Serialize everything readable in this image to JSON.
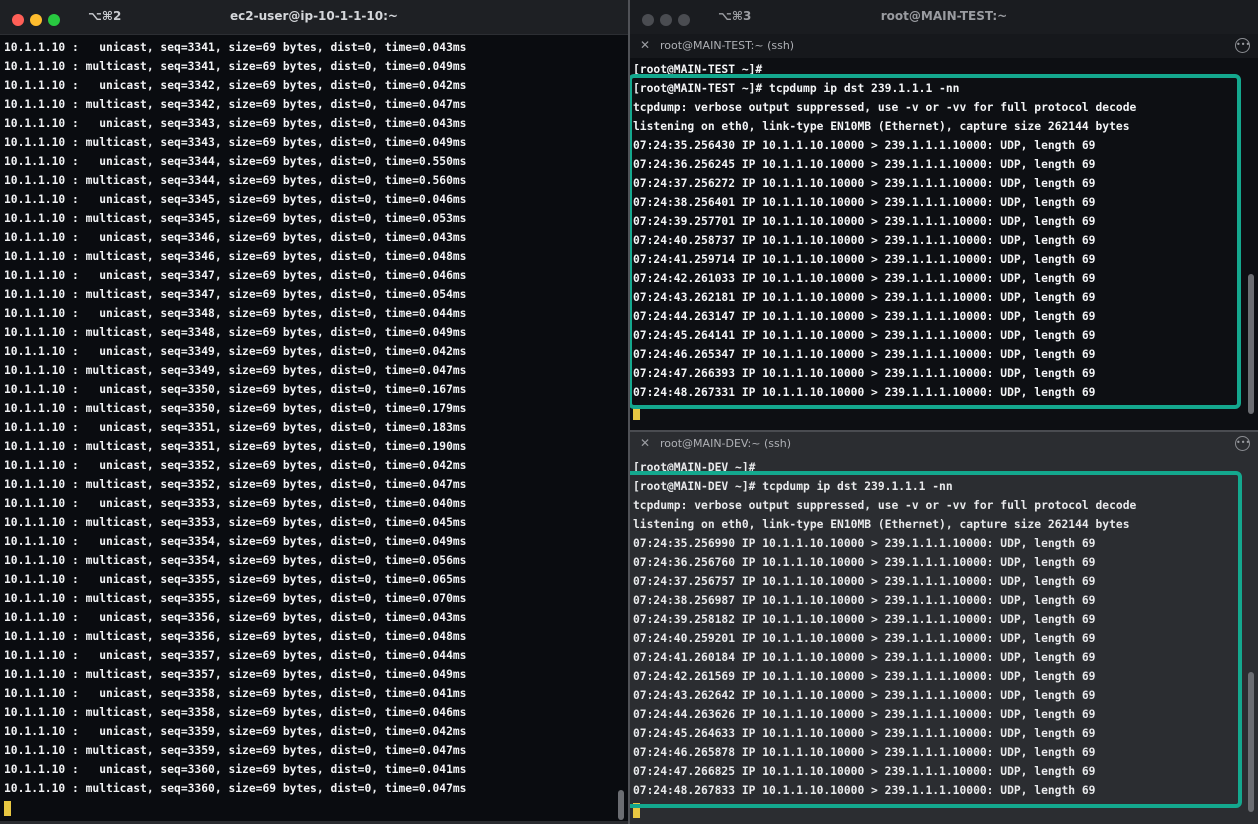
{
  "left_window": {
    "shortcut": "⌥⌘2",
    "title": "ec2-user@ip-10-1-1-10:~",
    "lines": [
      "10.1.1.10 :   unicast, seq=3341, size=69 bytes, dist=0, time=0.043ms",
      "10.1.1.10 : multicast, seq=3341, size=69 bytes, dist=0, time=0.049ms",
      "10.1.1.10 :   unicast, seq=3342, size=69 bytes, dist=0, time=0.042ms",
      "10.1.1.10 : multicast, seq=3342, size=69 bytes, dist=0, time=0.047ms",
      "10.1.1.10 :   unicast, seq=3343, size=69 bytes, dist=0, time=0.043ms",
      "10.1.1.10 : multicast, seq=3343, size=69 bytes, dist=0, time=0.049ms",
      "10.1.1.10 :   unicast, seq=3344, size=69 bytes, dist=0, time=0.550ms",
      "10.1.1.10 : multicast, seq=3344, size=69 bytes, dist=0, time=0.560ms",
      "10.1.1.10 :   unicast, seq=3345, size=69 bytes, dist=0, time=0.046ms",
      "10.1.1.10 : multicast, seq=3345, size=69 bytes, dist=0, time=0.053ms",
      "10.1.1.10 :   unicast, seq=3346, size=69 bytes, dist=0, time=0.043ms",
      "10.1.1.10 : multicast, seq=3346, size=69 bytes, dist=0, time=0.048ms",
      "10.1.1.10 :   unicast, seq=3347, size=69 bytes, dist=0, time=0.046ms",
      "10.1.1.10 : multicast, seq=3347, size=69 bytes, dist=0, time=0.054ms",
      "10.1.1.10 :   unicast, seq=3348, size=69 bytes, dist=0, time=0.044ms",
      "10.1.1.10 : multicast, seq=3348, size=69 bytes, dist=0, time=0.049ms",
      "10.1.1.10 :   unicast, seq=3349, size=69 bytes, dist=0, time=0.042ms",
      "10.1.1.10 : multicast, seq=3349, size=69 bytes, dist=0, time=0.047ms",
      "10.1.1.10 :   unicast, seq=3350, size=69 bytes, dist=0, time=0.167ms",
      "10.1.1.10 : multicast, seq=3350, size=69 bytes, dist=0, time=0.179ms",
      "10.1.1.10 :   unicast, seq=3351, size=69 bytes, dist=0, time=0.183ms",
      "10.1.1.10 : multicast, seq=3351, size=69 bytes, dist=0, time=0.190ms",
      "10.1.1.10 :   unicast, seq=3352, size=69 bytes, dist=0, time=0.042ms",
      "10.1.1.10 : multicast, seq=3352, size=69 bytes, dist=0, time=0.047ms",
      "10.1.1.10 :   unicast, seq=3353, size=69 bytes, dist=0, time=0.040ms",
      "10.1.1.10 : multicast, seq=3353, size=69 bytes, dist=0, time=0.045ms",
      "10.1.1.10 :   unicast, seq=3354, size=69 bytes, dist=0, time=0.049ms",
      "10.1.1.10 : multicast, seq=3354, size=69 bytes, dist=0, time=0.056ms",
      "10.1.1.10 :   unicast, seq=3355, size=69 bytes, dist=0, time=0.065ms",
      "10.1.1.10 : multicast, seq=3355, size=69 bytes, dist=0, time=0.070ms",
      "10.1.1.10 :   unicast, seq=3356, size=69 bytes, dist=0, time=0.043ms",
      "10.1.1.10 : multicast, seq=3356, size=69 bytes, dist=0, time=0.048ms",
      "10.1.1.10 :   unicast, seq=3357, size=69 bytes, dist=0, time=0.044ms",
      "10.1.1.10 : multicast, seq=3357, size=69 bytes, dist=0, time=0.049ms",
      "10.1.1.10 :   unicast, seq=3358, size=69 bytes, dist=0, time=0.041ms",
      "10.1.1.10 : multicast, seq=3358, size=69 bytes, dist=0, time=0.046ms",
      "10.1.1.10 :   unicast, seq=3359, size=69 bytes, dist=0, time=0.042ms",
      "10.1.1.10 : multicast, seq=3359, size=69 bytes, dist=0, time=0.047ms",
      "10.1.1.10 :   unicast, seq=3360, size=69 bytes, dist=0, time=0.041ms",
      "10.1.1.10 : multicast, seq=3360, size=69 bytes, dist=0, time=0.047ms"
    ]
  },
  "right_window": {
    "shortcut": "⌥⌘3",
    "title": "root@MAIN-TEST:~",
    "pane_test": {
      "tab_label": "root@MAIN-TEST:~ (ssh)",
      "lines": [
        "[root@MAIN-TEST ~]#",
        "[root@MAIN-TEST ~]# tcpdump ip dst 239.1.1.1 -nn",
        "tcpdump: verbose output suppressed, use -v or -vv for full protocol decode",
        "listening on eth0, link-type EN10MB (Ethernet), capture size 262144 bytes",
        "07:24:35.256430 IP 10.1.1.10.10000 > 239.1.1.1.10000: UDP, length 69",
        "07:24:36.256245 IP 10.1.1.10.10000 > 239.1.1.1.10000: UDP, length 69",
        "07:24:37.256272 IP 10.1.1.10.10000 > 239.1.1.1.10000: UDP, length 69",
        "07:24:38.256401 IP 10.1.1.10.10000 > 239.1.1.1.10000: UDP, length 69",
        "07:24:39.257701 IP 10.1.1.10.10000 > 239.1.1.1.10000: UDP, length 69",
        "07:24:40.258737 IP 10.1.1.10.10000 > 239.1.1.1.10000: UDP, length 69",
        "07:24:41.259714 IP 10.1.1.10.10000 > 239.1.1.1.10000: UDP, length 69",
        "07:24:42.261033 IP 10.1.1.10.10000 > 239.1.1.1.10000: UDP, length 69",
        "07:24:43.262181 IP 10.1.1.10.10000 > 239.1.1.1.10000: UDP, length 69",
        "07:24:44.263147 IP 10.1.1.10.10000 > 239.1.1.1.10000: UDP, length 69",
        "07:24:45.264141 IP 10.1.1.10.10000 > 239.1.1.1.10000: UDP, length 69",
        "07:24:46.265347 IP 10.1.1.10.10000 > 239.1.1.1.10000: UDP, length 69",
        "07:24:47.266393 IP 10.1.1.10.10000 > 239.1.1.1.10000: UDP, length 69",
        "07:24:48.267331 IP 10.1.1.10.10000 > 239.1.1.1.10000: UDP, length 69"
      ]
    },
    "pane_dev": {
      "tab_label": "root@MAIN-DEV:~ (ssh)",
      "lines": [
        "[root@MAIN-DEV ~]#",
        "[root@MAIN-DEV ~]# tcpdump ip dst 239.1.1.1 -nn",
        "tcpdump: verbose output suppressed, use -v or -vv for full protocol decode",
        "listening on eth0, link-type EN10MB (Ethernet), capture size 262144 bytes",
        "07:24:35.256990 IP 10.1.1.10.10000 > 239.1.1.1.10000: UDP, length 69",
        "07:24:36.256760 IP 10.1.1.10.10000 > 239.1.1.1.10000: UDP, length 69",
        "07:24:37.256757 IP 10.1.1.10.10000 > 239.1.1.1.10000: UDP, length 69",
        "07:24:38.256987 IP 10.1.1.10.10000 > 239.1.1.1.10000: UDP, length 69",
        "07:24:39.258182 IP 10.1.1.10.10000 > 239.1.1.1.10000: UDP, length 69",
        "07:24:40.259201 IP 10.1.1.10.10000 > 239.1.1.1.10000: UDP, length 69",
        "07:24:41.260184 IP 10.1.1.10.10000 > 239.1.1.1.10000: UDP, length 69",
        "07:24:42.261569 IP 10.1.1.10.10000 > 239.1.1.1.10000: UDP, length 69",
        "07:24:43.262642 IP 10.1.1.10.10000 > 239.1.1.1.10000: UDP, length 69",
        "07:24:44.263626 IP 10.1.1.10.10000 > 239.1.1.1.10000: UDP, length 69",
        "07:24:45.264633 IP 10.1.1.10.10000 > 239.1.1.1.10000: UDP, length 69",
        "07:24:46.265878 IP 10.1.1.10.10000 > 239.1.1.1.10000: UDP, length 69",
        "07:24:47.266825 IP 10.1.1.10.10000 > 239.1.1.1.10000: UDP, length 69",
        "07:24:48.267833 IP 10.1.1.10.10000 > 239.1.1.1.10000: UDP, length 69"
      ]
    }
  },
  "colors": {
    "highlight": "#14a88e",
    "cursor": "#e8c742",
    "close": "#ff5f57",
    "minimize": "#febc2e",
    "zoom": "#28c840",
    "inactive_light": "#4a4c51"
  },
  "icons": {
    "tab_close": "close-icon",
    "tab_more": "more-icon"
  }
}
